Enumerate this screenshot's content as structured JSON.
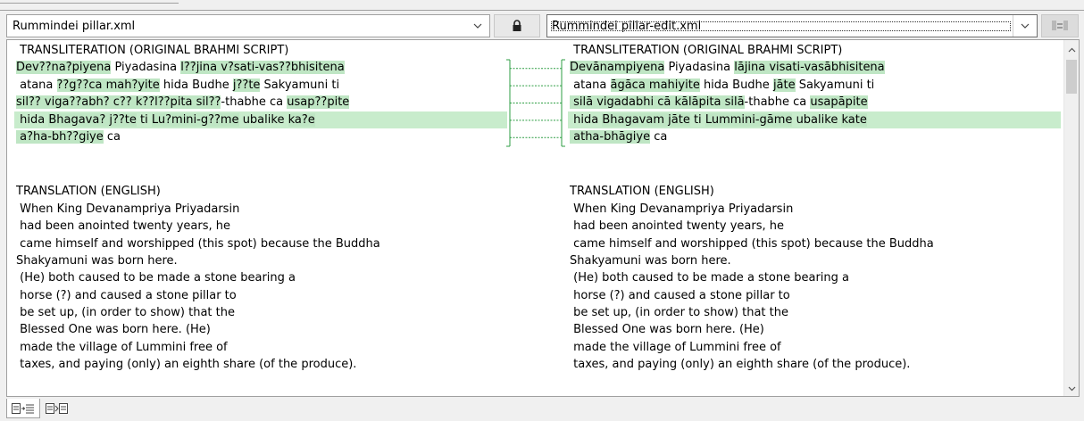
{
  "toolbar": {
    "left_file": "Rummindei pillar.xml",
    "right_file": "Rummindei pillar-edit.xml",
    "lock_icon": "padlock-icon",
    "right_button_icon": "merge-icon"
  },
  "colors": {
    "highlight": "#bfe6c4",
    "line_highlight": "#c8eccc",
    "connector": "#2e9e43"
  },
  "left": {
    "transliteration": {
      "heading": " TRANSLITERATION (ORIGINAL BRAHMI SCRIPT)",
      "lines": [
        {
          "full": false,
          "segments": [
            {
              "text": "Dev??na?piyena",
              "hl": true
            },
            {
              "text": " Piyadasina ",
              "hl": false
            },
            {
              "text": "l??jina v?sati-vas??bhisitena",
              "hl": true
            }
          ]
        },
        {
          "full": false,
          "segments": [
            {
              "text": " atana ",
              "hl": false
            },
            {
              "text": "??g??ca mah?yite",
              "hl": true
            },
            {
              "text": " hida Budhe ",
              "hl": false
            },
            {
              "text": "j??te",
              "hl": true
            },
            {
              "text": " Sakyamuni ti",
              "hl": false
            }
          ]
        },
        {
          "full": false,
          "segments": [
            {
              "text": "sil?? viga??abh? c?? k??l??pita sil??",
              "hl": true
            },
            {
              "text": "-thabhe ca ",
              "hl": false
            },
            {
              "text": "usap??pite",
              "hl": true
            }
          ]
        },
        {
          "full": true,
          "segments": [
            {
              "text": " hida ",
              "hl": false
            },
            {
              "text": "Bhagava? j??te",
              "hl": true
            },
            {
              "text": " ti ",
              "hl": false
            },
            {
              "text": "Lu?mini-g??me",
              "hl": true
            },
            {
              "text": " ubalike ",
              "hl": false
            },
            {
              "text": "ka?e",
              "hl": true
            }
          ]
        },
        {
          "full": false,
          "segments": [
            {
              "text": " a?ha-bh??giye",
              "hl": true
            },
            {
              "text": " ca",
              "hl": false
            }
          ]
        }
      ]
    },
    "translation": {
      "heading": "TRANSLATION (ENGLISH)",
      "lines": [
        " When King Devanampriya Priyadarsin",
        " had been anointed twenty years, he",
        " came himself and worshipped (this spot) because the Buddha",
        "Shakyamuni was born here.",
        " (He) both caused to be made a stone bearing a",
        " horse (?) and caused a stone pillar to",
        " be set up, (in order to show) that the",
        " Blessed One was born here. (He)",
        " made the village of Lummini free of",
        " taxes, and paying (only) an eighth share (of the produce)."
      ]
    }
  },
  "right": {
    "transliteration": {
      "heading": " TRANSLITERATION (ORIGINAL BRAHMI SCRIPT)",
      "lines": [
        {
          "full": false,
          "segments": [
            {
              "text": "Devānampiyena",
              "hl": true
            },
            {
              "text": " Piyadasina ",
              "hl": false
            },
            {
              "text": "lājina visati-vasābhisitena",
              "hl": true
            }
          ]
        },
        {
          "full": false,
          "segments": [
            {
              "text": " atana ",
              "hl": false
            },
            {
              "text": "āgāca mahiyite",
              "hl": true
            },
            {
              "text": " hida Budhe ",
              "hl": false
            },
            {
              "text": "jāte",
              "hl": true
            },
            {
              "text": " Sakyamuni ti",
              "hl": false
            }
          ]
        },
        {
          "full": false,
          "segments": [
            {
              "text": " silā vigadabhi cā kālāpita silā",
              "hl": true
            },
            {
              "text": "-thabhe ca ",
              "hl": false
            },
            {
              "text": "usapāpite",
              "hl": true
            }
          ]
        },
        {
          "full": true,
          "segments": [
            {
              "text": " hida ",
              "hl": false
            },
            {
              "text": "Bhagavam jāte",
              "hl": true
            },
            {
              "text": " ti ",
              "hl": false
            },
            {
              "text": "Lummini-gāme",
              "hl": true
            },
            {
              "text": " ubalike ",
              "hl": false
            },
            {
              "text": "kate",
              "hl": true
            }
          ]
        },
        {
          "full": false,
          "segments": [
            {
              "text": " atha-bhāgiye",
              "hl": true
            },
            {
              "text": " ca",
              "hl": false
            }
          ]
        }
      ]
    },
    "translation": {
      "heading": "TRANSLATION (ENGLISH)",
      "lines": [
        " When King Devanampriya Priyadarsin",
        " had been anointed twenty years, he",
        " came himself and worshipped (this spot) because the Buddha",
        "Shakyamuni was born here.",
        " (He) both caused to be made a stone bearing a",
        " horse (?) and caused a stone pillar to",
        " be set up, (in order to show) that the",
        " Blessed One was born here. (He)",
        " made the village of Lummini free of",
        " taxes, and paying (only) an eighth share (of the produce)."
      ]
    }
  },
  "bottom_tabs": [
    {
      "icon": "text-compare-view-icon",
      "active": true
    },
    {
      "icon": "structure-compare-view-icon",
      "active": false
    }
  ]
}
